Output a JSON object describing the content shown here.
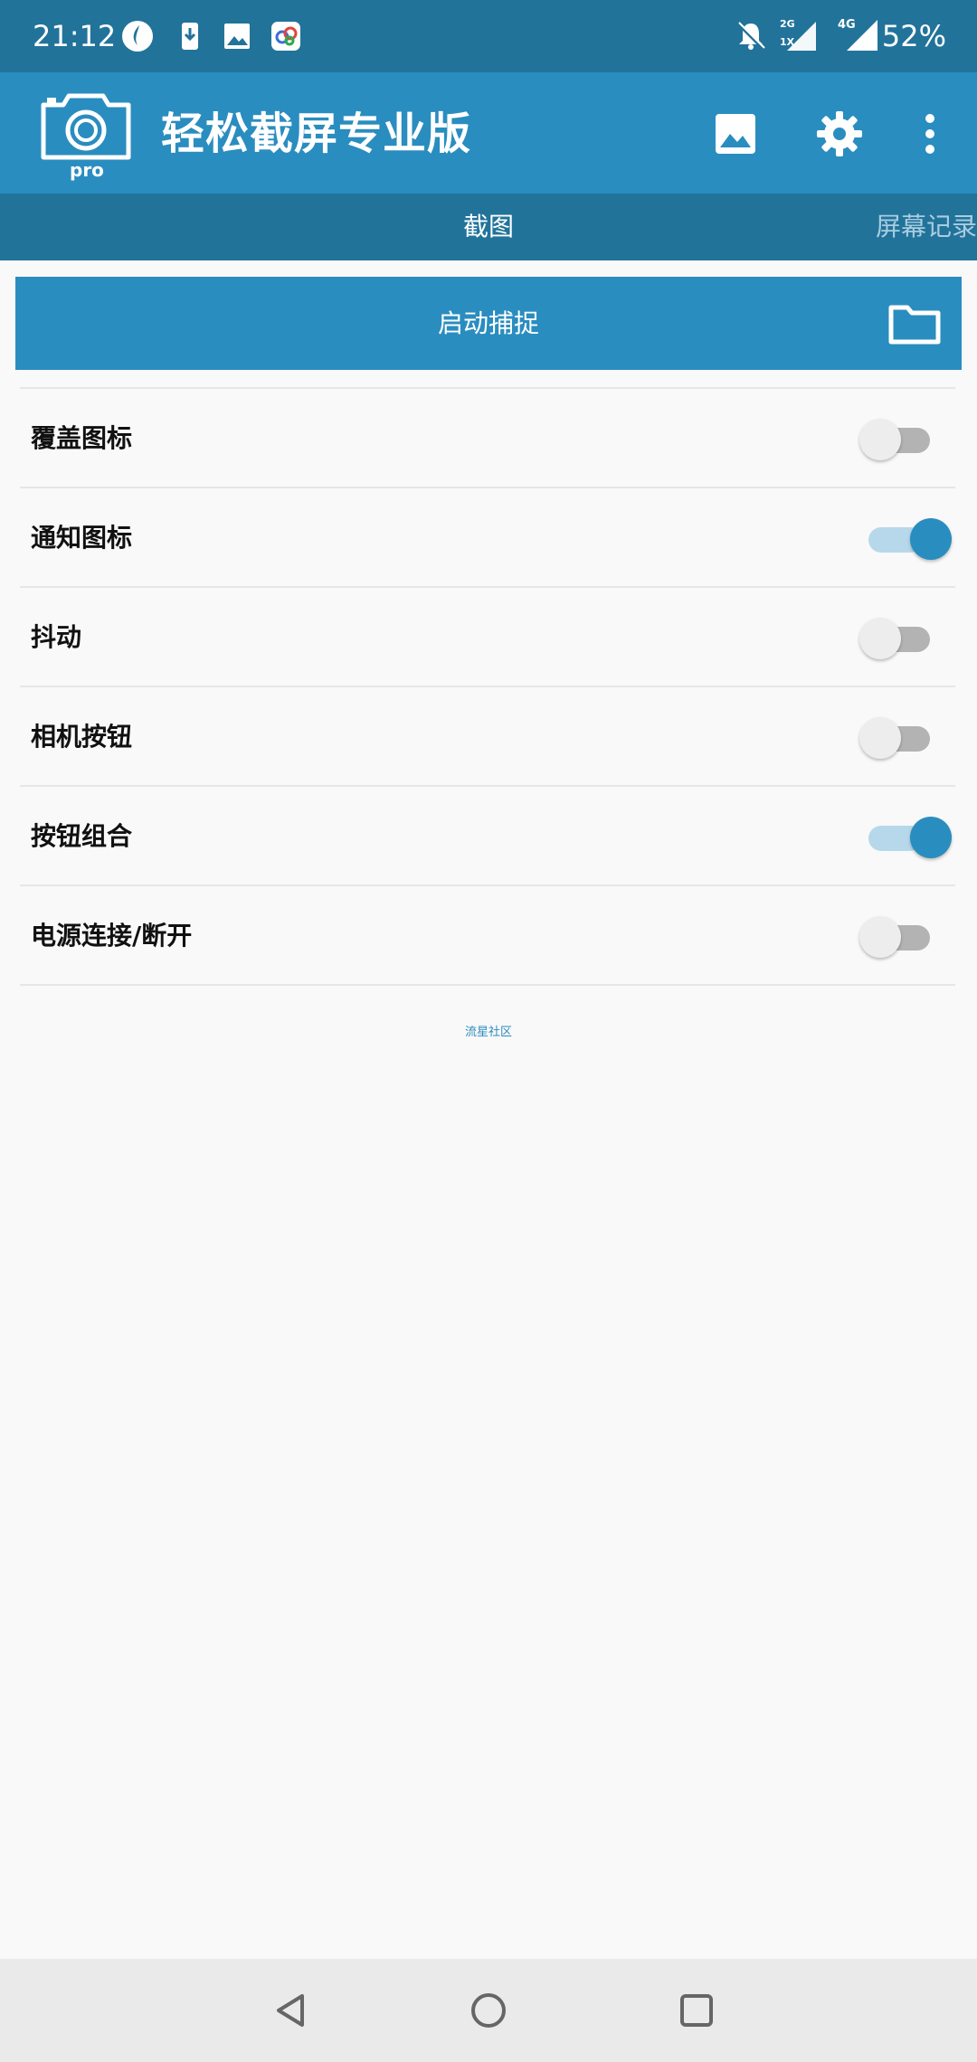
{
  "status_bar": {
    "time": "21:12",
    "battery": "52%",
    "network_labels": [
      "2G",
      "1X",
      "4G"
    ],
    "icons": [
      "app-notification-icon",
      "download-icon",
      "image-icon",
      "app-icon",
      "bell-off-icon",
      "signal-icon",
      "signal-icon"
    ]
  },
  "app_bar": {
    "title": "轻松截屏专业版",
    "logo_badge": "pro",
    "actions": [
      "gallery-icon",
      "settings-gear-icon",
      "more-vert-icon"
    ]
  },
  "tabs": [
    {
      "label": "截图",
      "active": true
    },
    {
      "label": "屏幕记录",
      "active": false
    }
  ],
  "capture": {
    "label": "启动捕捉",
    "icon": "folder-icon"
  },
  "settings": [
    {
      "label": "覆盖图标",
      "enabled": false
    },
    {
      "label": "通知图标",
      "enabled": true
    },
    {
      "label": "抖动",
      "enabled": false
    },
    {
      "label": "相机按钮",
      "enabled": false
    },
    {
      "label": "按钮组合",
      "enabled": true
    },
    {
      "label": "电源连接/断开",
      "enabled": false
    }
  ],
  "footer": {
    "link": "流星社区"
  },
  "colors": {
    "primary": "#2a8dbf",
    "primary_dark": "#22739a",
    "background": "#f9f9f9",
    "nav_bar": "#eaeaea"
  }
}
